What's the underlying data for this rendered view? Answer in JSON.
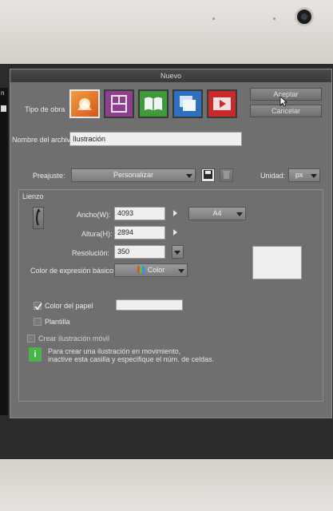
{
  "dialog": {
    "title": "Nuevo",
    "tipo_label": "Tipo de obra",
    "tiles": [
      "illustration-icon",
      "comic-page-icon",
      "webtoon-book-icon",
      "animation-cels-icon",
      "animation-video-icon"
    ],
    "aceptar": "Aceptar",
    "cancelar": "Cancelar",
    "nombre_label": "Nombre del archivo:",
    "nombre_value": "Ilustración",
    "preajuste_label": "Preajuste:",
    "preajuste_value": "Personalizar",
    "unidad_label": "Unidad:",
    "unidad_value": "px"
  },
  "lienzo": {
    "title": "Lienzo",
    "ancho_label": "Ancho(W):",
    "ancho_value": "4093",
    "altura_label": "Altura(H):",
    "altura_value": "2894",
    "resolucion_label": "Resolución:",
    "resolucion_value": "350",
    "size_preset": "A4",
    "color_label": "Color de expresión básico:",
    "color_value": "Color",
    "papel_label": "Color del papel",
    "papel_checked": true,
    "plantilla_label": "Plantilla",
    "plantilla_checked": false,
    "movil_label": "Crear ilustración móvil",
    "movil_checked": false,
    "info_line1": "Para crear una ilustración en movimiento,",
    "info_line2": "inactive esta casilla y especifique el núm. de celdas."
  },
  "left_strip_glyph": "n"
}
